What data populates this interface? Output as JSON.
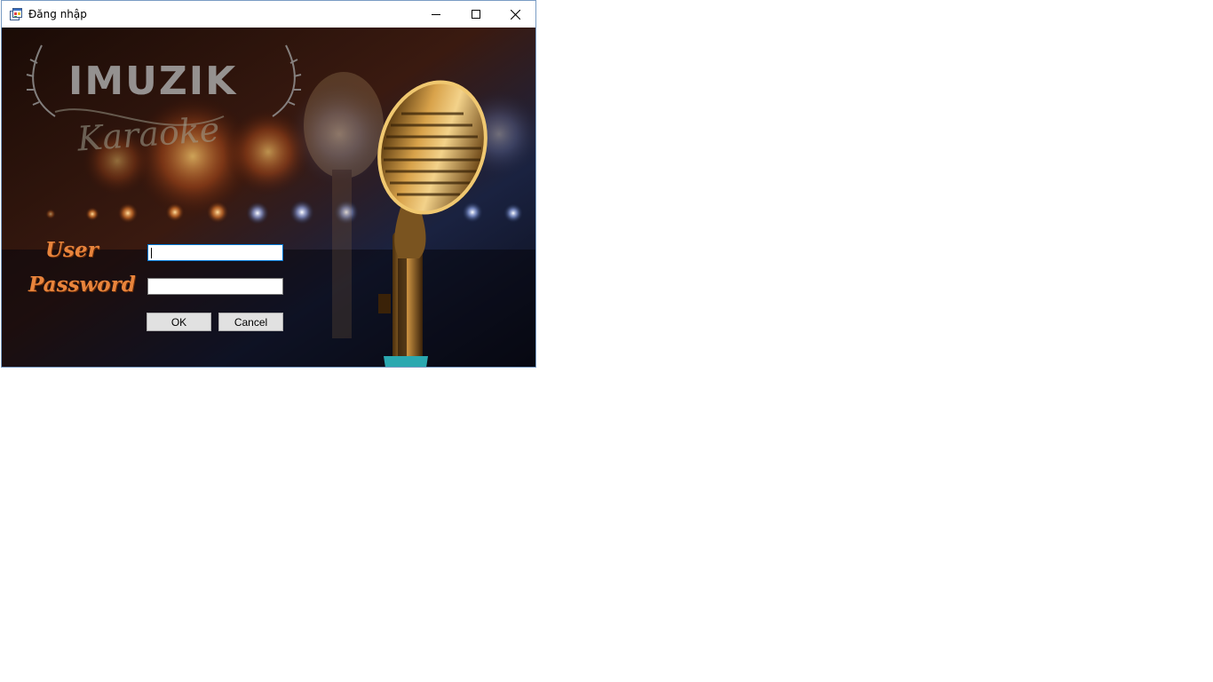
{
  "window": {
    "title": "Đăng nhập",
    "icon": "app-form-icon",
    "controls": [
      "minimize-icon",
      "maximize-icon",
      "close-icon"
    ]
  },
  "banner": {
    "logo_text": "IMUZIK",
    "logo_script": "Karaoke"
  },
  "form": {
    "user_label": "User",
    "password_label": "Password",
    "user_value": "",
    "password_value": "",
    "ok_label": "OK",
    "cancel_label": "Cancel"
  },
  "colors": {
    "label": "#e8843c",
    "focus_border": "#0078d7",
    "button_face": "#e1e1e1"
  }
}
